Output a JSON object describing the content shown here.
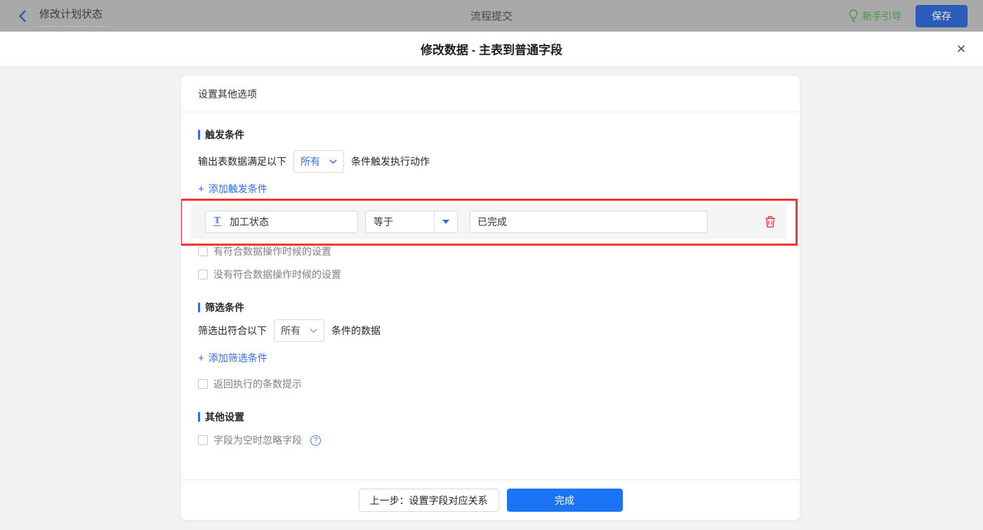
{
  "topbar": {
    "back_title": "修改计划状态",
    "center_title": "流程提交",
    "guide_label": "新手引导",
    "save_label": "保存"
  },
  "dialog": {
    "title": "修改数据 - 主表到普通字段",
    "close_glyph": "✕"
  },
  "panel": {
    "header": "设置其他选项",
    "trigger_section": {
      "title": "触发条件",
      "sentence_prefix": "输出表数据满足以下",
      "match_value": "所有",
      "sentence_suffix": "条件触发执行动作",
      "add_label": "添加触发条件",
      "condition": {
        "field": "加工状态",
        "operator": "等于",
        "value": "已完成"
      },
      "checkbox_has_match": "有符合数据操作时候的设置",
      "checkbox_no_match": "没有符合数据操作时候的设置"
    },
    "filter_section": {
      "title": "筛选条件",
      "sentence_prefix": "筛选出符合以下",
      "match_value": "所有",
      "sentence_suffix": "条件的数据",
      "add_label": "添加筛选条件",
      "checkbox_return_count": "返回执行的条数提示"
    },
    "other_section": {
      "title": "其他设置",
      "checkbox_ignore_empty": "字段为空时忽略字段"
    },
    "footer": {
      "prev_label": "上一步：设置字段对应关系",
      "done_label": "完成"
    }
  },
  "glyphs": {
    "plus": "+",
    "question": "?",
    "text_type": "T"
  },
  "colors": {
    "accent_blue": "#2F6CF6",
    "done_button_blue": "#1B74F3",
    "save_button_blue": "#2B5CBA",
    "guide_green": "#3F9A43",
    "danger_red": "#F5222D",
    "highlight_border_red": "#F23530",
    "topbar_gray": "#A9A9A9"
  }
}
